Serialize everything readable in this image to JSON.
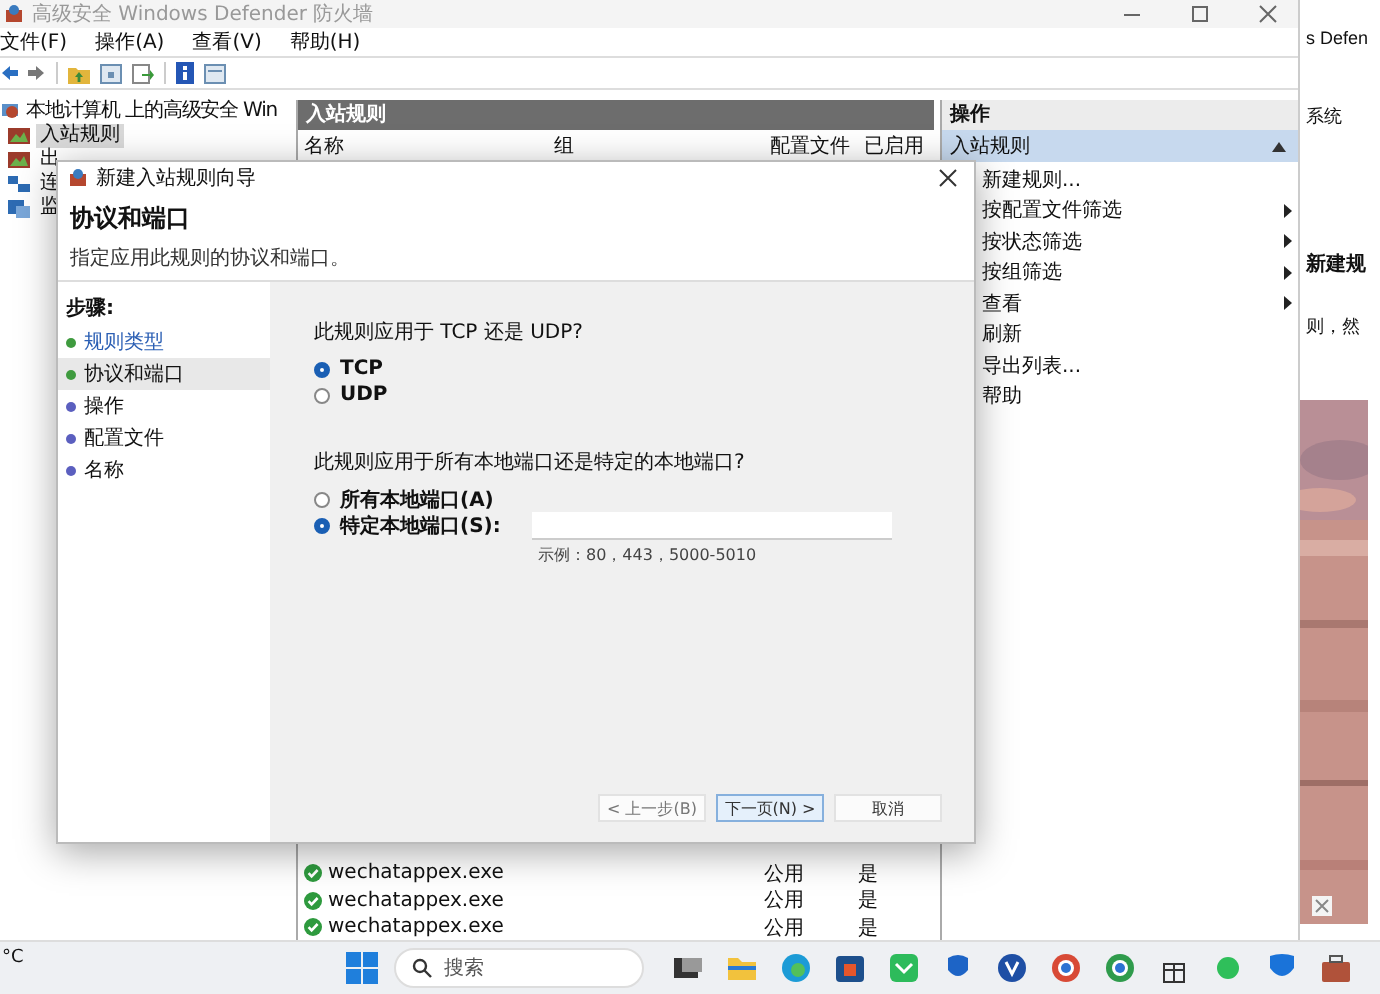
{
  "main_window": {
    "title": "高级安全 Windows Defender 防火墙",
    "menu": [
      "文件(F)",
      "操作(A)",
      "查看(V)",
      "帮助(H)"
    ],
    "tree": {
      "label": "本地计算机 上的高级安全 Win",
      "children": [
        {
          "label": "入站规则",
          "selected": true
        },
        {
          "label": "出",
          "selected": false
        },
        {
          "label": "连",
          "selected": false
        },
        {
          "label": "监",
          "selected": false
        }
      ]
    },
    "rules_pane": {
      "title": "入站规则",
      "columns": [
        "名称",
        "组",
        "配置文件",
        "已启用"
      ],
      "rows": [
        {
          "name": "wechatappex.exe",
          "profile": "公用",
          "enabled": "是"
        },
        {
          "name": "wechatappex.exe",
          "profile": "公用",
          "enabled": "是"
        },
        {
          "name": "wechatappex.exe",
          "profile": "公用",
          "enabled": "是"
        }
      ]
    },
    "actions_pane": {
      "title": "操作",
      "section": {
        "label": "入站规则",
        "expanded": true
      },
      "items": [
        {
          "label": "新建规则...",
          "submenu": false
        },
        {
          "label": "按配置文件筛选",
          "submenu": true
        },
        {
          "label": "按状态筛选",
          "submenu": true
        },
        {
          "label": "按组筛选",
          "submenu": true
        },
        {
          "label": "查看",
          "submenu": true
        },
        {
          "label": "刷新",
          "submenu": false
        },
        {
          "label": "导出列表...",
          "submenu": false
        },
        {
          "label": "帮助",
          "submenu": false
        }
      ]
    }
  },
  "dialog": {
    "title": "新建入站规则向导",
    "heading": "协议和端口",
    "subtitle": "指定应用此规则的协议和端口。",
    "steps_label": "步骤:",
    "steps": [
      {
        "label": "规则类型",
        "selected": false,
        "done": true
      },
      {
        "label": "协议和端口",
        "selected": true,
        "done": true
      },
      {
        "label": "操作",
        "selected": false,
        "done": false
      },
      {
        "label": "配置文件",
        "selected": false,
        "done": false
      },
      {
        "label": "名称",
        "selected": false,
        "done": false
      }
    ],
    "protocol": {
      "question": "此规则应用于 TCP 还是 UDP?",
      "options": [
        {
          "label": "TCP",
          "selected": true
        },
        {
          "label": "UDP",
          "selected": false
        }
      ]
    },
    "ports": {
      "question": "此规则应用于所有本地端口还是特定的本地端口?",
      "options": [
        {
          "label": "所有本地端口(A)",
          "selected": false
        },
        {
          "label": "特定本地端口(S):",
          "selected": true
        }
      ],
      "example": "示例：80，443，5000-5010"
    },
    "buttons": [
      {
        "label": "< 上一步(B)",
        "kind": "back"
      },
      {
        "label": "下一页(N) >",
        "kind": "next"
      },
      {
        "label": "取消",
        "kind": "cancel"
      }
    ]
  },
  "browser": {
    "texts": [
      {
        "text": "s Defen",
        "kind": "plain"
      },
      {
        "text": "系统",
        "kind": "plain"
      },
      {
        "text": "新建规",
        "kind": "heading"
      },
      {
        "text": "则，然",
        "kind": "plain"
      }
    ]
  },
  "taskbar": {
    "weather": "°C",
    "search_placeholder": "搜索"
  }
}
